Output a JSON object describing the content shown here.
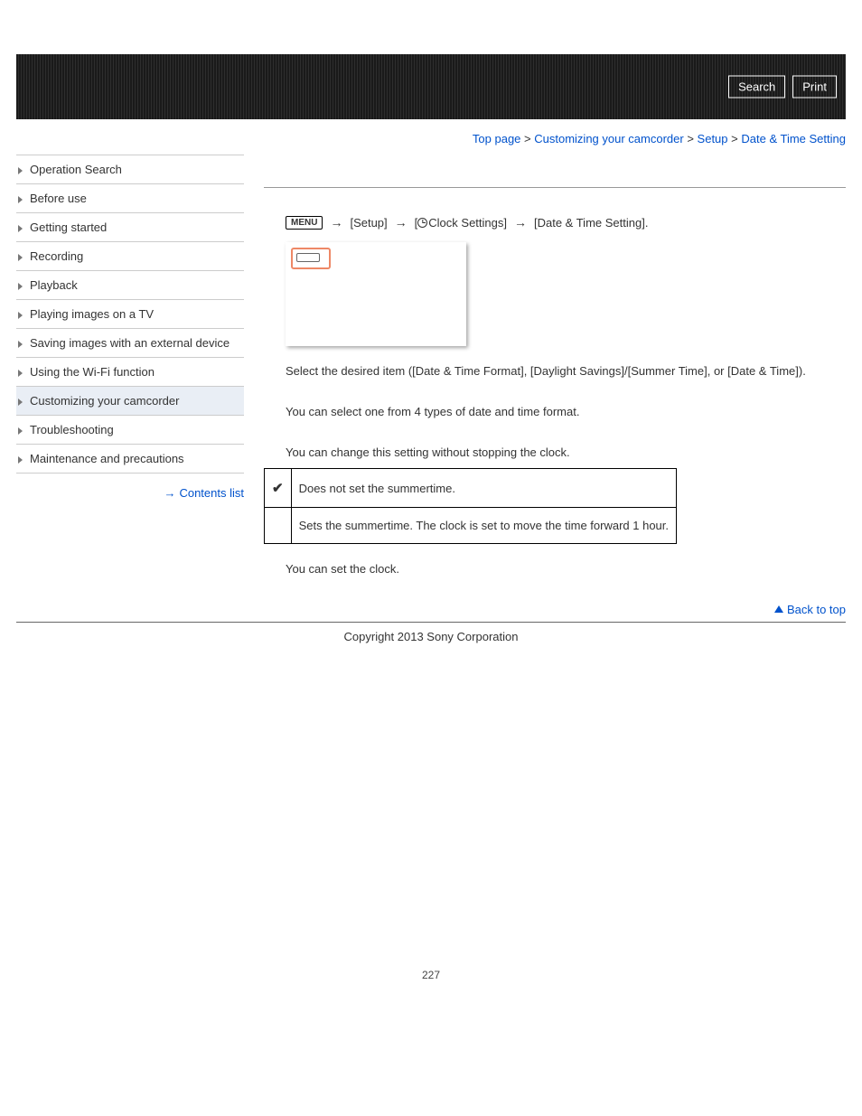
{
  "header": {
    "search_label": "Search",
    "print_label": "Print"
  },
  "breadcrumb": {
    "top": "Top page",
    "cust": "Customizing your camcorder",
    "setup": "Setup",
    "current": "Date & Time Setting"
  },
  "sidebar": {
    "items": [
      {
        "label": "Operation Search"
      },
      {
        "label": "Before use"
      },
      {
        "label": "Getting started"
      },
      {
        "label": "Recording"
      },
      {
        "label": "Playback"
      },
      {
        "label": "Playing images on a TV"
      },
      {
        "label": "Saving images with an external device"
      },
      {
        "label": "Using the Wi-Fi function"
      },
      {
        "label": "Customizing your camcorder"
      },
      {
        "label": "Troubleshooting"
      },
      {
        "label": "Maintenance and precautions"
      }
    ],
    "contents_list": "Contents list"
  },
  "steps": {
    "menu_icon_text": "MENU",
    "setup": "[Setup]",
    "clock_settings": "Clock Settings]",
    "date_time": "[Date & Time Setting].",
    "arrow": "→"
  },
  "instruction2": "Select the desired item ([Date & Time Format], [Daylight Savings]/[Summer Time], or [Date & Time]).",
  "format_text": "You can select one from 4 types of date and time format.",
  "summer_intro": "You can change this setting without stopping the clock.",
  "summer_table": {
    "row1": "Does not set the summertime.",
    "row2": "Sets the summertime. The clock is set to move the time forward 1 hour.",
    "check": "✔"
  },
  "clock_text": "You can set the clock.",
  "back_to_top": "Back to top",
  "copyright": "Copyright 2013 Sony Corporation",
  "page_number": "227"
}
